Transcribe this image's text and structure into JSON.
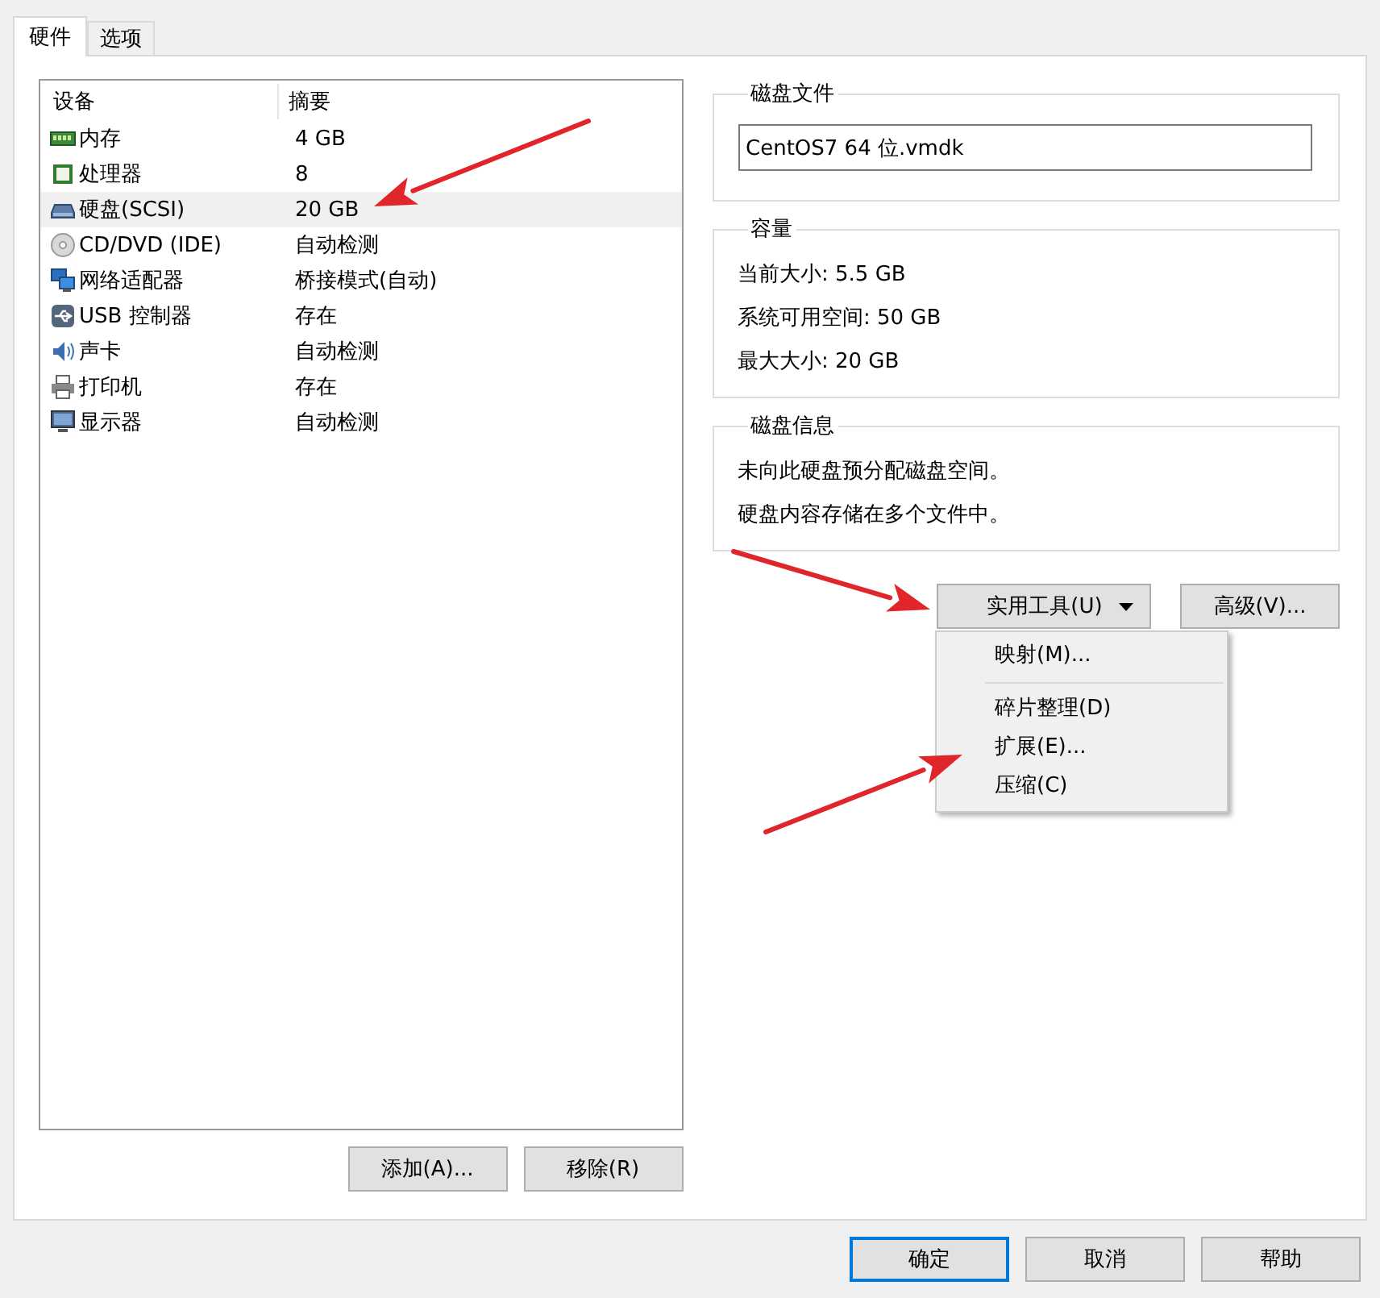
{
  "tabs": [
    {
      "label": "硬件",
      "selected": true
    },
    {
      "label": "选项",
      "selected": false
    }
  ],
  "device_list": {
    "columns": [
      "设备",
      "摘要"
    ],
    "rows": [
      {
        "kind": "memory",
        "device": "内存",
        "summary": "4 GB",
        "selected": false
      },
      {
        "kind": "cpu",
        "device": "处理器",
        "summary": "8",
        "selected": false
      },
      {
        "kind": "disk",
        "device": "硬盘(SCSI)",
        "summary": "20 GB",
        "selected": true
      },
      {
        "kind": "cdrom",
        "device": "CD/DVD (IDE)",
        "summary": "自动检测",
        "selected": false
      },
      {
        "kind": "network",
        "device": "网络适配器",
        "summary": "桥接模式(自动)",
        "selected": false
      },
      {
        "kind": "usb",
        "device": "USB 控制器",
        "summary": "存在",
        "selected": false
      },
      {
        "kind": "sound",
        "device": "声卡",
        "summary": "自动检测",
        "selected": false
      },
      {
        "kind": "printer",
        "device": "打印机",
        "summary": "存在",
        "selected": false
      },
      {
        "kind": "display",
        "device": "显示器",
        "summary": "自动检测",
        "selected": false
      }
    ]
  },
  "list_buttons": [
    "添加(A)...",
    "移除(R)"
  ],
  "disk_file": {
    "title": "磁盘文件",
    "value": "CentOS7 64 位.vmdk"
  },
  "capacity": {
    "title": "容量",
    "lines": [
      "当前大小: 5.5 GB",
      "系统可用空间: 50 GB",
      "最大大小: 20 GB"
    ]
  },
  "disk_info": {
    "title": "磁盘信息",
    "lines": [
      "未向此硬盘预分配磁盘空间。",
      "硬盘内容存储在多个文件中。"
    ]
  },
  "utilities_button": {
    "label": "实用工具(U)",
    "expanded": true
  },
  "advanced_button": "高级(V)...",
  "utilities_menu": [
    {
      "kind": "item",
      "label": "映射(M)..."
    },
    {
      "kind": "separator"
    },
    {
      "kind": "item",
      "label": "碎片整理(D)"
    },
    {
      "kind": "item",
      "label": "扩展(E)..."
    },
    {
      "kind": "item",
      "label": "压缩(C)"
    }
  ],
  "dialog_buttons": [
    {
      "label": "确定",
      "default": true
    },
    {
      "label": "取消",
      "default": false
    },
    {
      "label": "帮助",
      "default": false
    }
  ]
}
